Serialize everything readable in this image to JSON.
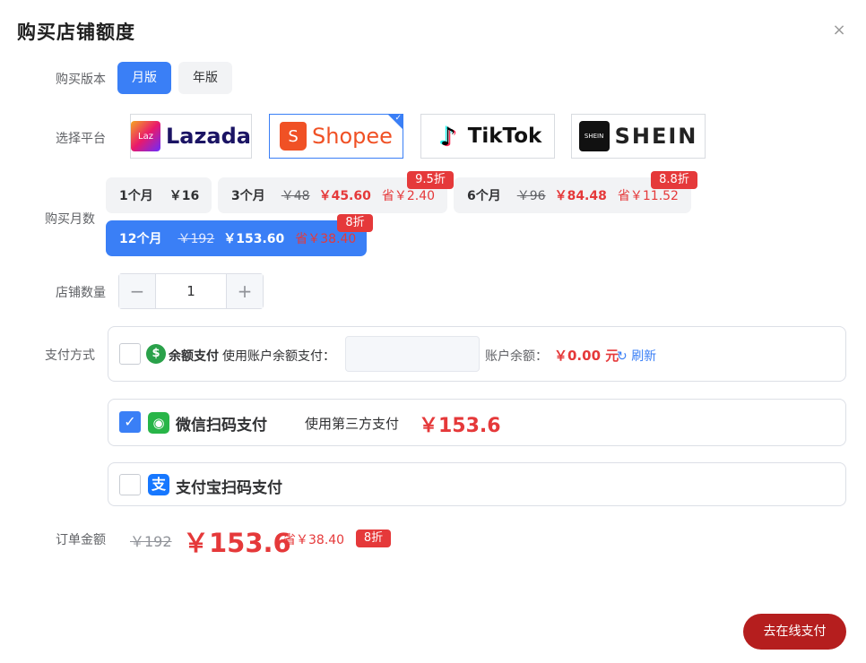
{
  "dialog": {
    "title": "购买店铺额度",
    "close_label": "×"
  },
  "version": {
    "label": "购买版本",
    "options": [
      {
        "label": "月版",
        "selected": true
      },
      {
        "label": "年版",
        "selected": false
      }
    ]
  },
  "platform": {
    "label": "选择平台",
    "options": [
      {
        "name": "Lazada",
        "badge": "Laz",
        "selected": false
      },
      {
        "name": "Shopee",
        "badge": "S",
        "selected": true
      },
      {
        "name": "TikTok",
        "badge": "♪",
        "selected": false
      },
      {
        "name": "SHEIN",
        "badge": "SHEIN",
        "selected": false
      }
    ]
  },
  "months": {
    "label": "购买月数",
    "options": [
      {
        "label": "1个月",
        "old": "",
        "price": "￥16",
        "save": "",
        "discount": "",
        "selected": false
      },
      {
        "label": "3个月",
        "old": "￥48",
        "price": "￥45.60",
        "save": "省￥2.40",
        "discount": "9.5折",
        "selected": false
      },
      {
        "label": "6个月",
        "old": "￥96",
        "price": "￥84.48",
        "save": "省￥11.52",
        "discount": "8.8折",
        "selected": false
      },
      {
        "label": "12个月",
        "old": "￥192",
        "price": "￥153.60",
        "save": "省￥38.40",
        "discount": "8折",
        "selected": true
      }
    ]
  },
  "quantity": {
    "label": "店铺数量",
    "value": "1",
    "minus": "−",
    "plus": "+"
  },
  "payment": {
    "label": "支付方式",
    "balance": {
      "title": "余额支付",
      "desc": "使用账户余额支付：",
      "input_value": "",
      "account_label": "账户余额：",
      "account_value": "￥0.00 元",
      "refresh_label": "刷新",
      "checked": false
    },
    "wechat": {
      "title": "微信扫码支付",
      "desc": "使用第三方支付",
      "amount": "￥153.6",
      "checked": true
    },
    "alipay": {
      "title": "支付宝扫码支付",
      "checked": false
    }
  },
  "order": {
    "label": "订单金额",
    "old": "￥192",
    "price": "￥153.6",
    "save": "省￥38.40",
    "discount": "8折"
  },
  "submit_label": "去在线支付",
  "colors": {
    "primary": "#3a7ff6",
    "price_red": "#e5393a",
    "pay_button": "#b51e1e",
    "wechat_green": "#28b548",
    "alipay_blue": "#1677ff",
    "balance_green": "#2aa14a",
    "shopee_orange": "#f05125",
    "lazada_navy": "#1b1464"
  }
}
